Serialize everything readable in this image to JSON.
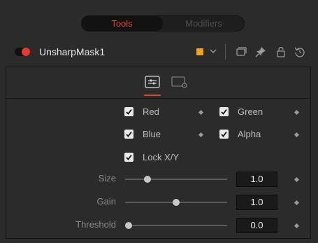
{
  "tabs": {
    "tools_label": "Tools",
    "modifiers_label": "Modifiers",
    "active": "Tools"
  },
  "header": {
    "node_name": "UnsharpMask1",
    "node_enabled": true,
    "color_swatch": "#f5a21b",
    "icons": [
      "chevron-down-icon",
      "window-icon",
      "pin-icon",
      "lock-icon",
      "reset-icon"
    ]
  },
  "panel": {
    "tabs": [
      {
        "icon": "sliders-icon",
        "active": true
      },
      {
        "icon": "settings-icon",
        "active": false
      }
    ],
    "channels": [
      {
        "label": "Red",
        "checked": true
      },
      {
        "label": "Green",
        "checked": true
      },
      {
        "label": "Blue",
        "checked": true
      },
      {
        "label": "Alpha",
        "checked": true
      }
    ],
    "lock_xy": {
      "label": "Lock X/Y",
      "checked": true
    },
    "sliders": [
      {
        "label": "Size",
        "value": "1.0",
        "fraction": 0.2
      },
      {
        "label": "Gain",
        "value": "1.0",
        "fraction": 0.5
      },
      {
        "label": "Threshold",
        "value": "0.0",
        "fraction": 0.0
      }
    ]
  },
  "colors": {
    "accent": "#e0452b",
    "toggle_on": "#e8392b",
    "background": "#2b2b2b"
  }
}
